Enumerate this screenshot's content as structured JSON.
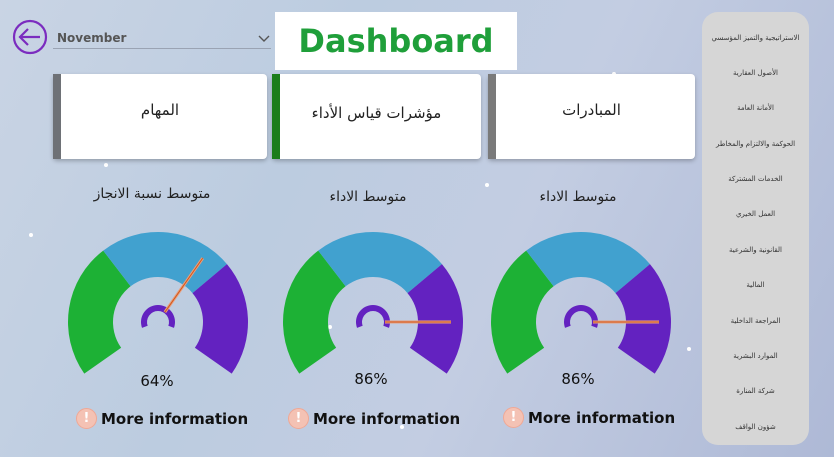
{
  "header": {
    "month": "November",
    "title": "Dashboard"
  },
  "cards": [
    {
      "label": "المهام",
      "stripe_color": "#6e7176"
    },
    {
      "label": "مؤشرات قياس الأداء",
      "stripe_color": "#1b7d1b"
    },
    {
      "label": "المبادرات",
      "stripe_color": "#7a7a7a"
    }
  ],
  "gauges": [
    {
      "label": "متوسط نسبة الانجاز",
      "value_text": "64%",
      "value": 64,
      "more": "More information"
    },
    {
      "label": "متوسط الاداء",
      "value_text": "86%",
      "value": 86,
      "more": "More information"
    },
    {
      "label": "متوسط الاداء",
      "value_text": "86%",
      "value": 86,
      "more": "More information"
    }
  ],
  "colors": {
    "green": "#1db135",
    "blue": "#41a1cf",
    "purple": "#6322c0",
    "title_green": "#1f9f3a",
    "back_icon": "#7b2cbf"
  },
  "sidebar": {
    "items": [
      "الاستراتيجية والتميز المؤسسي",
      "الأصول العقارية",
      "الأمانة العامة",
      "الحوكمة والالتزام والمخاطر",
      "الخدمات المشتركة",
      "العمل الخيري",
      "القانونية والشرعية",
      "المالية",
      "المراجعة الداخلية",
      "الموارد البشرية",
      "شركة المنارة",
      "شؤون الواقف"
    ]
  }
}
